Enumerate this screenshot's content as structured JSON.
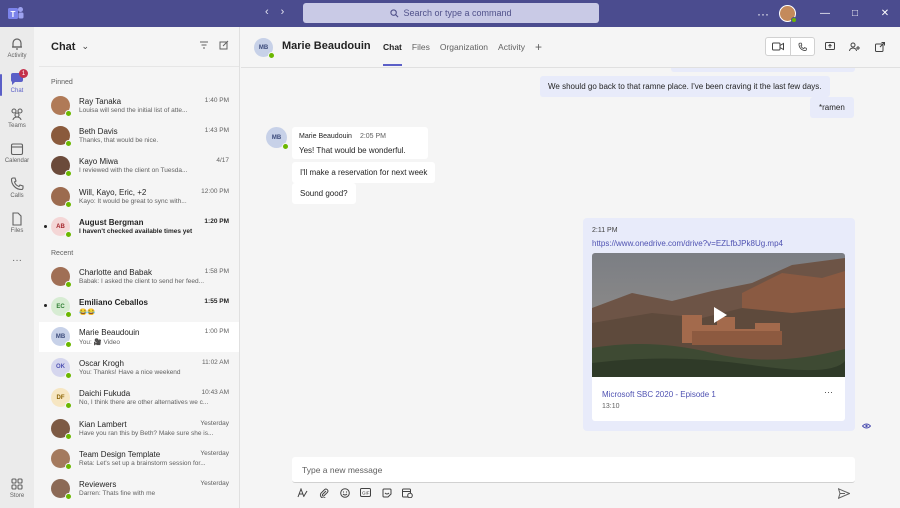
{
  "titlebar": {
    "search_placeholder": "Search or type a command",
    "more": "···",
    "win_min": "—",
    "win_max": "□",
    "win_close": "✕",
    "back": "‹",
    "forward": "›"
  },
  "rail": {
    "items": [
      {
        "label": "Activity"
      },
      {
        "label": "Chat",
        "badge": "1"
      },
      {
        "label": "Teams"
      },
      {
        "label": "Calendar"
      },
      {
        "label": "Calls"
      },
      {
        "label": "Files"
      },
      {
        "label": "···"
      },
      {
        "label": "Store"
      }
    ]
  },
  "chatpane": {
    "title": "Chat",
    "pinned_label": "Pinned",
    "recent_label": "Recent",
    "pinned": [
      {
        "name": "Ray Tanaka",
        "time": "1:40 PM",
        "preview": "Louisa will send the initial list of atte...",
        "avatar_color": "#b07a57"
      },
      {
        "name": "Beth Davis",
        "time": "1:43 PM",
        "preview": "Thanks, that would be nice.",
        "avatar_color": "#8a5a3c"
      },
      {
        "name": "Kayo Miwa",
        "time": "4/17",
        "preview": "I reviewed with the client on Tuesda...",
        "avatar_color": "#6b4a3a"
      },
      {
        "name": "Will, Kayo, Eric, +2",
        "time": "12:00 PM",
        "preview": "Kayo: It would be great to sync with...",
        "avatar_color": "#9c6b4f"
      },
      {
        "name": "August Bergman",
        "time": "1:20 PM",
        "preview": "I haven't checked available times yet",
        "initials": "AB",
        "avatar_color": "#f4d6d6",
        "initials_color": "#a4262c",
        "bold": true
      }
    ],
    "recent": [
      {
        "name": "Charlotte and Babak",
        "time": "1:58 PM",
        "preview": "Babak: I asked the client to send her feed...",
        "avatar_color": "#a06f55"
      },
      {
        "name": "Emiliano Ceballos",
        "time": "1:55 PM",
        "preview": "😂😂",
        "initials": "EC",
        "avatar_color": "#d7ecd3",
        "initials_color": "#2e7d32",
        "bold": true
      },
      {
        "name": "Marie Beaudouin",
        "time": "1:00 PM",
        "preview": "You: 🎥 Video",
        "initials": "MB",
        "avatar_color": "#c7d1e8",
        "initials_color": "#3b4a7a",
        "selected": true
      },
      {
        "name": "Oscar Krogh",
        "time": "11:02 AM",
        "preview": "You: Thanks! Have a nice weekend",
        "initials": "OK",
        "avatar_color": "#d5d6ee",
        "initials_color": "#4f52b2"
      },
      {
        "name": "Daichi Fukuda",
        "time": "10:43 AM",
        "preview": "No, I think there are other alternatives we c...",
        "initials": "DF",
        "avatar_color": "#f6e6c2",
        "initials_color": "#8a6100"
      },
      {
        "name": "Kian Lambert",
        "time": "Yesterday",
        "preview": "Have you ran this by Beth? Make sure she is...",
        "avatar_color": "#7d5a44"
      },
      {
        "name": "Team Design Template",
        "time": "Yesterday",
        "preview": "Reta: Let's set up a brainstorm session for...",
        "avatar_color": "#a47a5e"
      },
      {
        "name": "Reviewers",
        "time": "Yesterday",
        "preview": "Darren: Thats fine with me",
        "avatar_color": "#8c6a56"
      }
    ]
  },
  "main": {
    "contact_name": "Marie Beaudouin",
    "contact_initials": "MB",
    "tabs": [
      "Chat",
      "Files",
      "Organization",
      "Activity"
    ],
    "plus": "+",
    "messages_mine_top": [
      {
        "text": "We should go back to that ramne place. I've been craving it the last few days."
      },
      {
        "text": "*ramen"
      }
    ],
    "incoming": {
      "author": "Marie Beaudouin",
      "time": "2:05 PM",
      "messages": [
        {
          "text": "Yes! That would be wonderful."
        },
        {
          "text": "I'll make a reservation for next week"
        },
        {
          "text": "Sound good?"
        }
      ]
    },
    "video": {
      "time": "2:11 PM",
      "link": "https://www.onedrive.com/drive?v=EZLfbJPk8Ug.mp4",
      "title": "Microsoft SBC 2020 - Episode 1",
      "duration": "13:10",
      "more": "···"
    },
    "compose_placeholder": "Type a new message"
  },
  "colors": {
    "brand": "#4b4c8f",
    "accent": "#5b5fc7",
    "link": "#4f52b2",
    "presence": "#6bb700",
    "badge": "#c4314b"
  }
}
